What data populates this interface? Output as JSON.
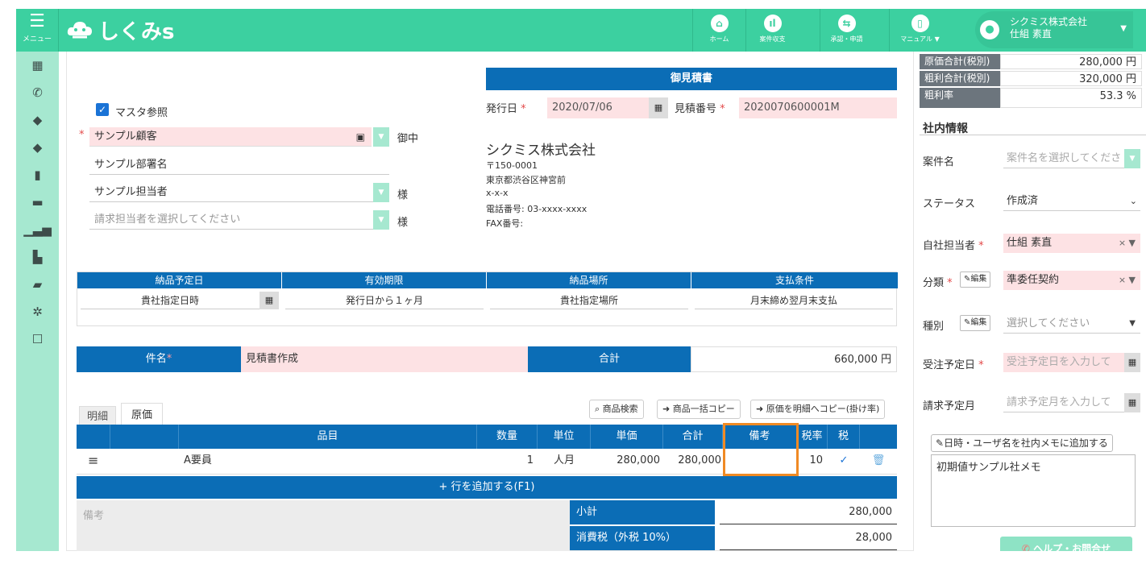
{
  "header": {
    "menu_label": "メニュー",
    "logo_text": "しくみs",
    "nav": [
      {
        "label": "ホーム",
        "icon": "home-icon"
      },
      {
        "label": "案件収支",
        "icon": "chart-icon"
      },
      {
        "label": "承認・申請",
        "icon": "approval-icon"
      },
      {
        "label": "マニュアル ▼",
        "icon": "manual-icon"
      }
    ],
    "user_company": "シクミス株式会社",
    "user_name": "仕組 素直"
  },
  "sidebar_icons": [
    "calendar-icon",
    "phone-icon",
    "tag-icon",
    "tags-icon",
    "bar-chart-icon",
    "card-icon",
    "signal-icon",
    "file-icon",
    "folder-icon",
    "gear-icon",
    "checkbox-icon"
  ],
  "estimate": {
    "master_ref_label": "マスタ参照",
    "customer": "サンプル顧客",
    "customer_suffix": "御中",
    "department": "サンプル部署名",
    "contact": "サンプル担当者",
    "contact_suffix": "様",
    "billing_placeholder": "請求担当者を選択してください",
    "billing_suffix": "様",
    "doc_title": "御見積書",
    "issue_date_label": "発行日",
    "issue_date": "2020/07/06",
    "number_label": "見積番号",
    "number": "2020070600001M",
    "company_name": "シクミス株式会社",
    "postal": "〒150-0001",
    "address": "東京都渋谷区神宮前",
    "address2": "x-x-x",
    "tel": "電話番号: 03-xxxx-xxxx",
    "fax": "FAX番号:",
    "terms_headers": [
      "納品予定日",
      "有効期限",
      "納品場所",
      "支払条件"
    ],
    "terms_values": [
      "貴社指定日時",
      "発行日から１ヶ月",
      "貴社指定場所",
      "月末締め翌月末支払"
    ],
    "subject_label": "件名",
    "subject": "見積書作成",
    "total_label": "合計",
    "total": "660,000 円",
    "tabs": [
      "明細",
      "原価"
    ],
    "buttons": [
      "商品検索",
      "商品一括コピー",
      "原価を明細へコピー(掛け率)"
    ],
    "columns": [
      "品目",
      "数量",
      "単位",
      "単価",
      "合計",
      "備考",
      "税率",
      "税"
    ],
    "row": {
      "item": "A要員",
      "qty": "1",
      "unit": "人月",
      "price": "280,000",
      "total": "280,000",
      "note": "",
      "tax": "10"
    },
    "add_row": "+ 行を追加する(F1)",
    "remarks_label": "備考",
    "subtotal_label": "小計",
    "subtotal": "280,000",
    "tax_label": "消費税（外税 10%）",
    "tax_amount": "28,000"
  },
  "right": {
    "cost_rows": [
      {
        "label": "原価合計(税別)",
        "value": "280,000 円"
      },
      {
        "label": "粗利合計(税別)",
        "value": "320,000 円"
      },
      {
        "label": "粗利率",
        "value": "53.3 %"
      }
    ],
    "section_title": "社内情報",
    "project_label": "案件名",
    "project_placeholder": "案件名を選択してくださ",
    "status_label": "ステータス",
    "status_value": "作成済",
    "owner_label": "自社担当者",
    "owner_value": "仕組 素直",
    "category_label": "分類",
    "category_value": "準委任契約",
    "type_label": "種別",
    "type_placeholder": "選択してください",
    "edit_label": "編集",
    "order_date_label": "受注予定日",
    "order_date_placeholder": "受注予定日を入力して",
    "billing_month_label": "請求予定月",
    "billing_month_placeholder": "請求予定月を入力して",
    "memo_button": "日時・ユーザ名を社内メモに追加する",
    "memo_text": "初期値サンプル社メモ",
    "help_button": "ヘルプ・お問合せ"
  },
  "colors": {
    "brand": "#3cd0a0",
    "primary": "#0b6db6",
    "required_bg": "#fde2e4",
    "highlight": "#f08a24"
  }
}
